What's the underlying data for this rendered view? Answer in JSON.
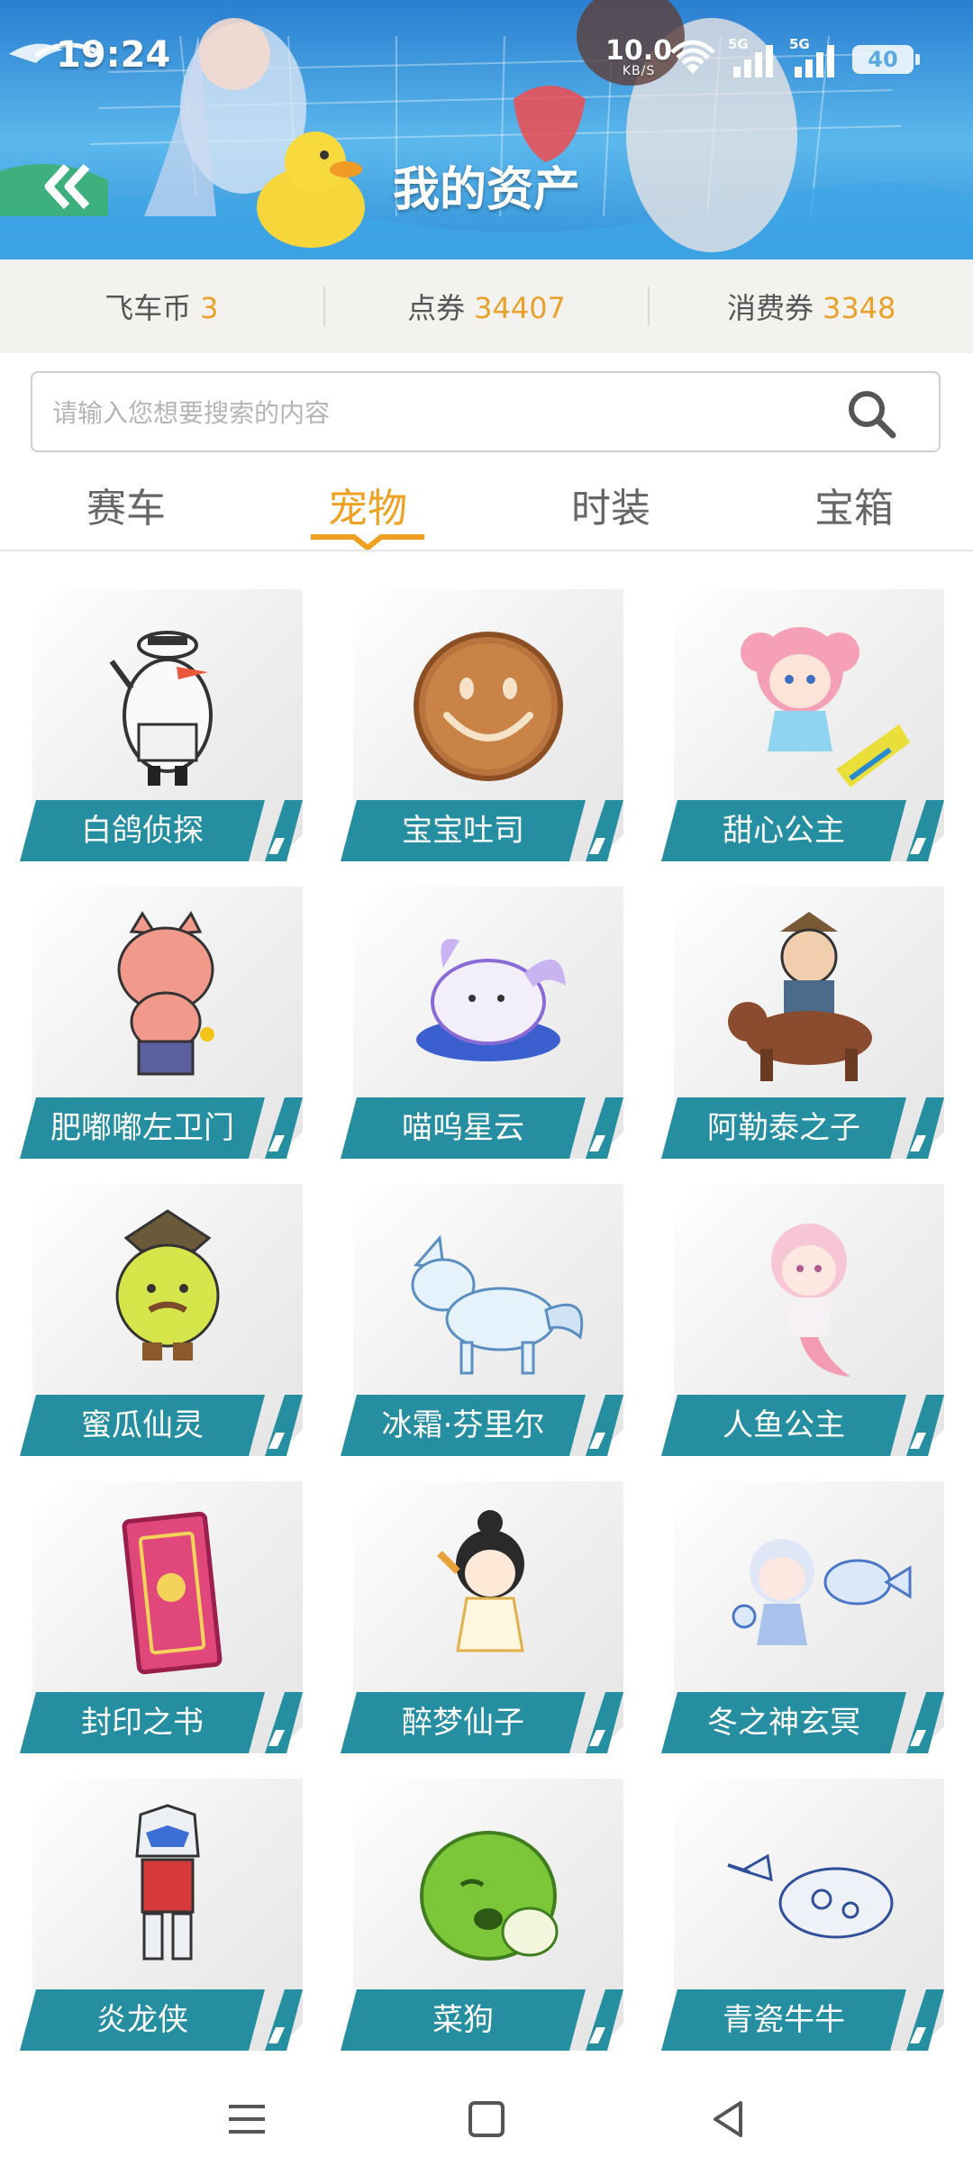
{
  "status_bar": {
    "time": "19:24",
    "net_speed": "10.0",
    "net_unit": "KB/S",
    "signal1_label": "5G",
    "signal2_label": "5G",
    "battery": "40",
    "icons": [
      "wifi-icon",
      "signal-icon",
      "signal-icon",
      "battery-icon"
    ]
  },
  "header": {
    "back_icon": "double-chevron-left-icon",
    "title": "我的资产"
  },
  "balances": [
    {
      "label": "飞车币",
      "value": "3"
    },
    {
      "label": "点券",
      "value": "34407"
    },
    {
      "label": "消费券",
      "value": "3348"
    }
  ],
  "search": {
    "placeholder": "请输入您想要搜索的内容",
    "value": "",
    "icon": "search-icon"
  },
  "tabs": [
    {
      "label": "赛车",
      "active": false
    },
    {
      "label": "宠物",
      "active": true
    },
    {
      "label": "时装",
      "active": false
    },
    {
      "label": "宝箱",
      "active": false
    }
  ],
  "pets": [
    {
      "name": "白鸽侦探"
    },
    {
      "name": "宝宝吐司"
    },
    {
      "name": "甜心公主"
    },
    {
      "name": "肥嘟嘟左卫门"
    },
    {
      "name": "喵呜星云"
    },
    {
      "name": "阿勒泰之子"
    },
    {
      "name": "蜜瓜仙灵"
    },
    {
      "name": "冰霜·芬里尔"
    },
    {
      "name": "人鱼公主"
    },
    {
      "name": "封印之书"
    },
    {
      "name": "醉梦仙子"
    },
    {
      "name": "冬之神玄冥"
    },
    {
      "name": "炎龙侠"
    },
    {
      "name": "菜狗"
    },
    {
      "name": "青瓷牛牛"
    }
  ],
  "colors": {
    "accent": "#f0a020",
    "value": "#e8a12a",
    "label_bg": "#258ea1",
    "header_blue": "#2b86d4"
  },
  "nav_bar": {
    "icons": [
      "menu-icon",
      "home-square-icon",
      "back-triangle-icon"
    ]
  }
}
